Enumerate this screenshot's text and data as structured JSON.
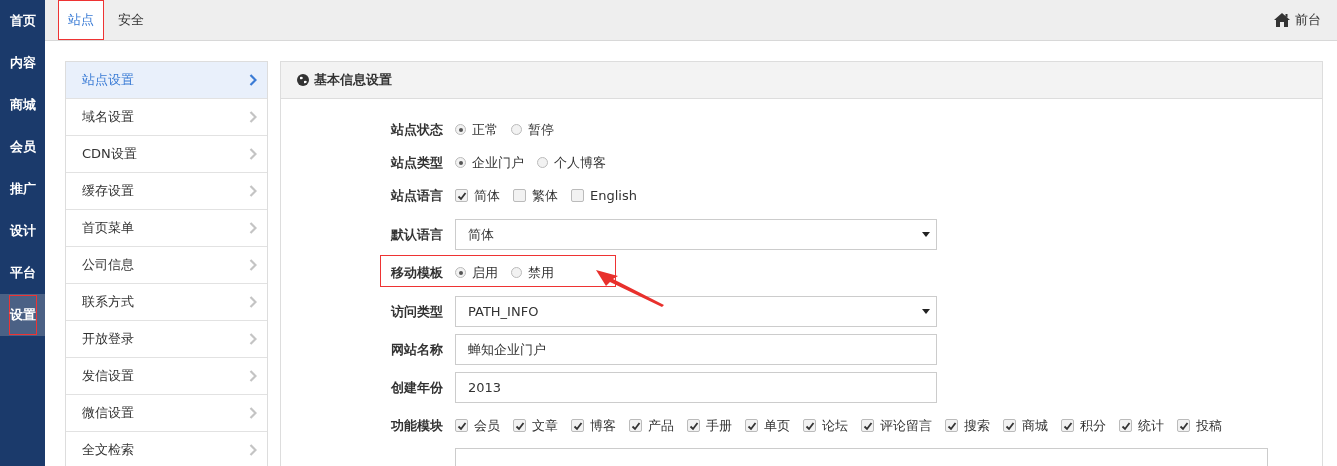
{
  "nav": [
    {
      "label": "首页",
      "selected": false,
      "highlighted": false
    },
    {
      "label": "内容",
      "selected": false,
      "highlighted": false
    },
    {
      "label": "商城",
      "selected": false,
      "highlighted": false
    },
    {
      "label": "会员",
      "selected": false,
      "highlighted": false
    },
    {
      "label": "推广",
      "selected": false,
      "highlighted": false
    },
    {
      "label": "设计",
      "selected": false,
      "highlighted": false
    },
    {
      "label": "平台",
      "selected": false,
      "highlighted": false
    },
    {
      "label": "设置",
      "selected": true,
      "highlighted": true
    }
  ],
  "tabs": [
    {
      "label": "站点",
      "selected": true,
      "highlighted": true
    },
    {
      "label": "安全",
      "selected": false,
      "highlighted": false
    }
  ],
  "frontend_link": "前台",
  "side_menu": [
    {
      "label": "站点设置",
      "selected": true
    },
    {
      "label": "域名设置",
      "selected": false
    },
    {
      "label": "CDN设置",
      "selected": false
    },
    {
      "label": "缓存设置",
      "selected": false
    },
    {
      "label": "首页菜单",
      "selected": false
    },
    {
      "label": "公司信息",
      "selected": false
    },
    {
      "label": "联系方式",
      "selected": false
    },
    {
      "label": "开放登录",
      "selected": false
    },
    {
      "label": "发信设置",
      "selected": false
    },
    {
      "label": "微信设置",
      "selected": false
    },
    {
      "label": "全文检索",
      "selected": false
    }
  ],
  "panel": {
    "title": "基本信息设置",
    "rows": [
      {
        "kind": "radio",
        "label": "站点状态",
        "highlighted": false,
        "options": [
          {
            "label": "正常",
            "selected": true
          },
          {
            "label": "暂停",
            "selected": false
          }
        ]
      },
      {
        "kind": "radio",
        "label": "站点类型",
        "highlighted": false,
        "options": [
          {
            "label": "企业门户",
            "selected": true
          },
          {
            "label": "个人博客",
            "selected": false
          }
        ]
      },
      {
        "kind": "checkbox",
        "label": "站点语言",
        "highlighted": false,
        "options": [
          {
            "label": "简体",
            "checked": true
          },
          {
            "label": "繁体",
            "checked": false
          },
          {
            "label": "English",
            "checked": false
          }
        ]
      },
      {
        "kind": "select",
        "label": "默认语言",
        "highlighted": false,
        "value": "简体"
      },
      {
        "kind": "radio",
        "label": "移动模板",
        "highlighted": true,
        "options": [
          {
            "label": "启用",
            "selected": true
          },
          {
            "label": "禁用",
            "selected": false
          }
        ]
      },
      {
        "kind": "select",
        "label": "访问类型",
        "highlighted": false,
        "value": "PATH_INFO"
      },
      {
        "kind": "text",
        "label": "网站名称",
        "highlighted": false,
        "value": "蝉知企业门户"
      },
      {
        "kind": "text",
        "label": "创建年份",
        "highlighted": false,
        "value": "2013"
      },
      {
        "kind": "checkbox",
        "label": "功能模块",
        "highlighted": false,
        "options": [
          {
            "label": "会员",
            "checked": true
          },
          {
            "label": "文章",
            "checked": true
          },
          {
            "label": "博客",
            "checked": true
          },
          {
            "label": "产品",
            "checked": true
          },
          {
            "label": "手册",
            "checked": true
          },
          {
            "label": "单页",
            "checked": true
          },
          {
            "label": "论坛",
            "checked": true
          },
          {
            "label": "评论留言",
            "checked": true
          },
          {
            "label": "搜索",
            "checked": true
          },
          {
            "label": "商城",
            "checked": true
          },
          {
            "label": "积分",
            "checked": true
          },
          {
            "label": "统计",
            "checked": true
          },
          {
            "label": "投稿",
            "checked": true
          }
        ]
      },
      {
        "kind": "textarea",
        "highlighted": false
      }
    ]
  }
}
